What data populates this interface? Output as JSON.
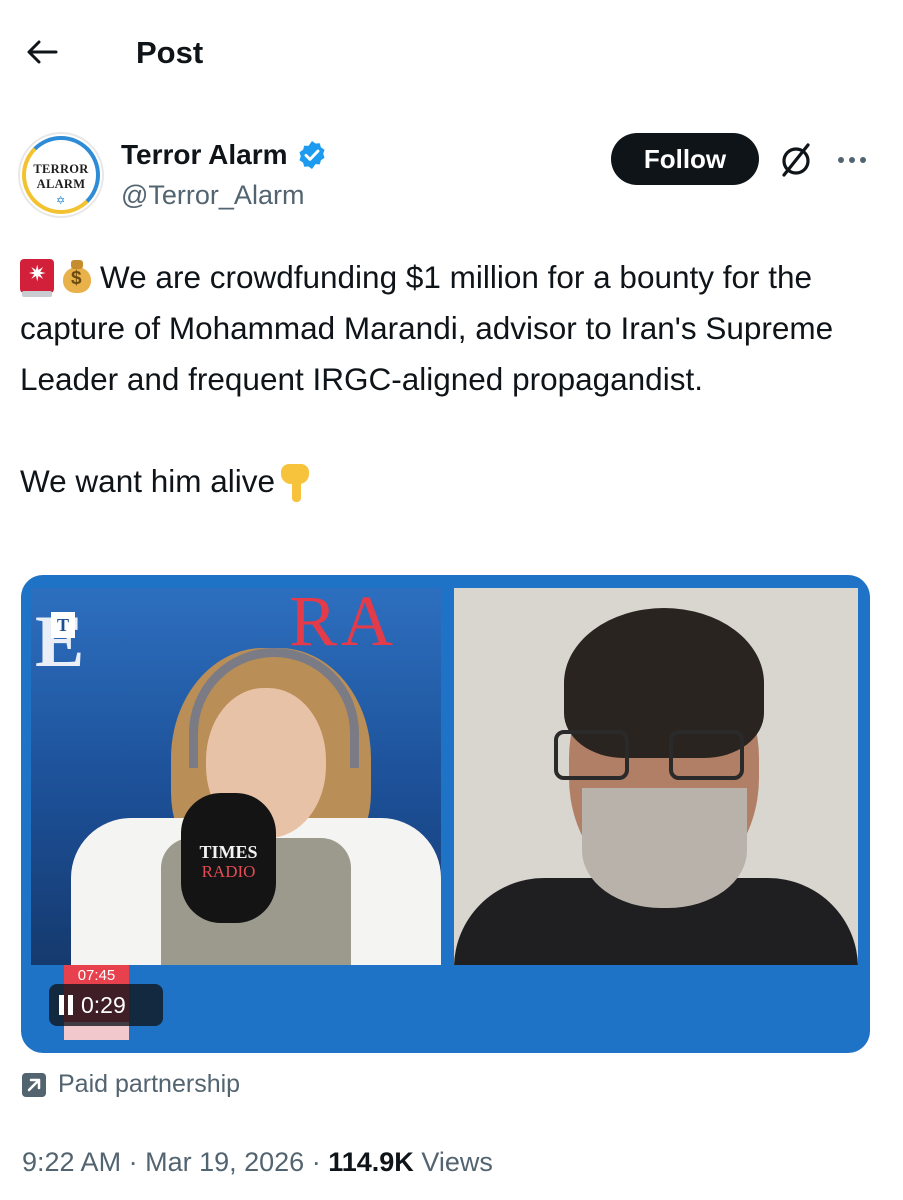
{
  "header": {
    "title": "Post"
  },
  "author": {
    "name": "Terror Alarm",
    "handle": "@Terror_Alarm",
    "avatar_text_line1": "TERROR",
    "avatar_text_line2": "ALARM",
    "verified": true,
    "follow_label": "Follow"
  },
  "tweet": {
    "paragraph1": "We are crowdfunding $1 million for a bounty for the capture of Mohammad Marandi, advisor to Iran's Supreme Leader and frequent IRGC-aligned propagandist.",
    "paragraph2": "We want him alive",
    "emojis": [
      "police-siren-icon",
      "money-bag-icon",
      "pointing-down-icon"
    ]
  },
  "media": {
    "studio_logo_letter": "T",
    "studio_logo_e": "E",
    "studio_logo_ra": "RA",
    "mic_label_line1": "TIMES",
    "mic_label_line2": "RADIO",
    "broadcast_time": "07:45",
    "player_time": "0:29",
    "player_state": "playing"
  },
  "paid_partnership": {
    "label": "Paid partnership"
  },
  "meta": {
    "time": "9:22 AM",
    "separator": "·",
    "date": "Mar 19, 2026",
    "views_count": "114.9K",
    "views_label": "Views"
  },
  "colors": {
    "accent_verified": "#1d9bf0",
    "text_primary": "#0f1419",
    "text_secondary": "#536471",
    "follow_bg": "#0f1419",
    "media_frame": "#1f73c6"
  }
}
